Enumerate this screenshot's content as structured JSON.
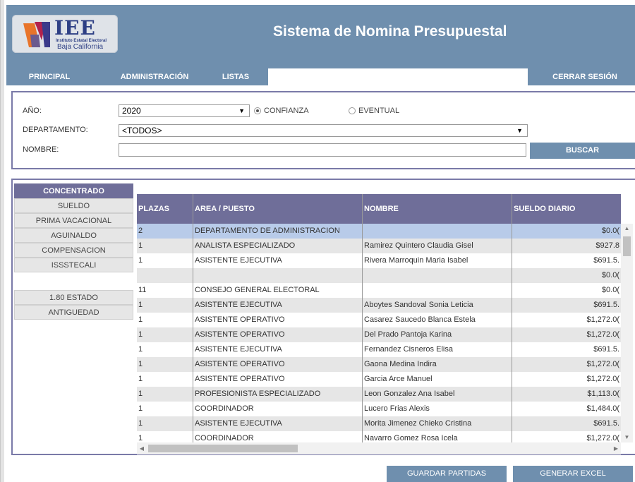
{
  "header": {
    "logo_text": "IEE",
    "logo_sub1": "Instituto Estatal Electoral",
    "logo_sub2": "Baja California",
    "title": "Sistema de Nomina Presupuestal"
  },
  "nav": {
    "principal": "PRINCIPAL",
    "administracion": "ADMINISTRACIÓN",
    "listas": "LISTAS",
    "cerrar_sesion": "CERRAR SESIÓN"
  },
  "filters": {
    "anio_label": "AÑO:",
    "anio_value": "2020",
    "confianza_label": "CONFIANZA",
    "eventual_label": "EVENTUAL",
    "departamento_label": "DEPARTAMENTO:",
    "departamento_value": "<TODOS>",
    "nombre_label": "NOMBRE:",
    "nombre_value": "",
    "buscar_label": "BUSCAR"
  },
  "side_tabs": {
    "concentrado": "CONCENTRADO",
    "sueldo": "SUELDO",
    "prima": "PRIMA VACACIONAL",
    "aguinaldo": "AGUINALDO",
    "compensacion": "COMPENSACION",
    "issstecali": "ISSSTECALI",
    "estado": "1.80 ESTADO",
    "antiguedad": "ANTIGUEDAD"
  },
  "table": {
    "columns": [
      "PLAZAS",
      "AREA / PUESTO",
      "NOMBRE",
      "SUELDO DIARIO"
    ],
    "rows": [
      {
        "plazas": "2",
        "area": "DEPARTAMENTO DE ADMINISTRACION",
        "nombre": "",
        "sueldo": "$0.0("
      },
      {
        "plazas": "1",
        "area": "ANALISTA ESPECIALIZADO",
        "nombre": "Ramirez Quintero Claudia Gisel",
        "sueldo": "$927.8"
      },
      {
        "plazas": "1",
        "area": "ASISTENTE EJECUTIVA",
        "nombre": "Rivera Marroquin Maria Isabel",
        "sueldo": "$691.5."
      },
      {
        "plazas": "",
        "area": "",
        "nombre": "",
        "sueldo": "$0.0("
      },
      {
        "plazas": "11",
        "area": "CONSEJO GENERAL ELECTORAL",
        "nombre": "",
        "sueldo": "$0.0("
      },
      {
        "plazas": "1",
        "area": "ASISTENTE EJECUTIVA",
        "nombre": "Aboytes Sandoval Sonia Leticia",
        "sueldo": "$691.5."
      },
      {
        "plazas": "1",
        "area": "ASISTENTE OPERATIVO",
        "nombre": "Casarez Saucedo Blanca Estela",
        "sueldo": "$1,272.0("
      },
      {
        "plazas": "1",
        "area": "ASISTENTE OPERATIVO",
        "nombre": "Del Prado Pantoja Karina",
        "sueldo": "$1,272.0("
      },
      {
        "plazas": "1",
        "area": "ASISTENTE EJECUTIVA",
        "nombre": "Fernandez Cisneros Elisa",
        "sueldo": "$691.5."
      },
      {
        "plazas": "1",
        "area": "ASISTENTE OPERATIVO",
        "nombre": "Gaona Medina Indira",
        "sueldo": "$1,272.0("
      },
      {
        "plazas": "1",
        "area": "ASISTENTE OPERATIVO",
        "nombre": "Garcia Arce Manuel",
        "sueldo": "$1,272.0("
      },
      {
        "plazas": "1",
        "area": "PROFESIONISTA ESPECIALIZADO",
        "nombre": "Leon Gonzalez Ana Isabel",
        "sueldo": "$1,113.0("
      },
      {
        "plazas": "1",
        "area": "COORDINADOR",
        "nombre": "Lucero Frias Alexis",
        "sueldo": "$1,484.0("
      },
      {
        "plazas": "1",
        "area": "ASISTENTE EJECUTIVA",
        "nombre": "Morita Jimenez Chieko Cristina",
        "sueldo": "$691.5."
      },
      {
        "plazas": "1",
        "area": "COORDINADOR",
        "nombre": "Navarro Gomez Rosa Icela",
        "sueldo": "$1,272.0("
      }
    ]
  },
  "actions": {
    "guardar": "GUARDAR PARTIDAS",
    "excel": "GENERAR EXCEL"
  },
  "colors": {
    "header": "#6f8fae",
    "grid_header": "#6f6e99",
    "selected_row": "#b8cbe9"
  }
}
